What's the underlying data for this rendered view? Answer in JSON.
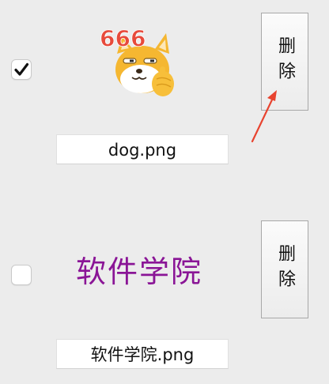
{
  "items": [
    {
      "checked": true,
      "image_content": "dog-666-sticker",
      "filename": "dog.png",
      "delete_label": "删除"
    },
    {
      "checked": false,
      "image_content": "text",
      "image_text": "软件学院",
      "filename": "软件学院.png",
      "delete_label": "删除"
    }
  ],
  "sticker_text": "666",
  "colors": {
    "background": "#ececec",
    "image_text": "#8a1596",
    "annotation_arrow": "#e8432f",
    "sticker_numbers": "#e74a3b",
    "dog_fur": "#f5b731"
  },
  "annotation": {
    "type": "arrow",
    "points_to": "delete-button"
  }
}
